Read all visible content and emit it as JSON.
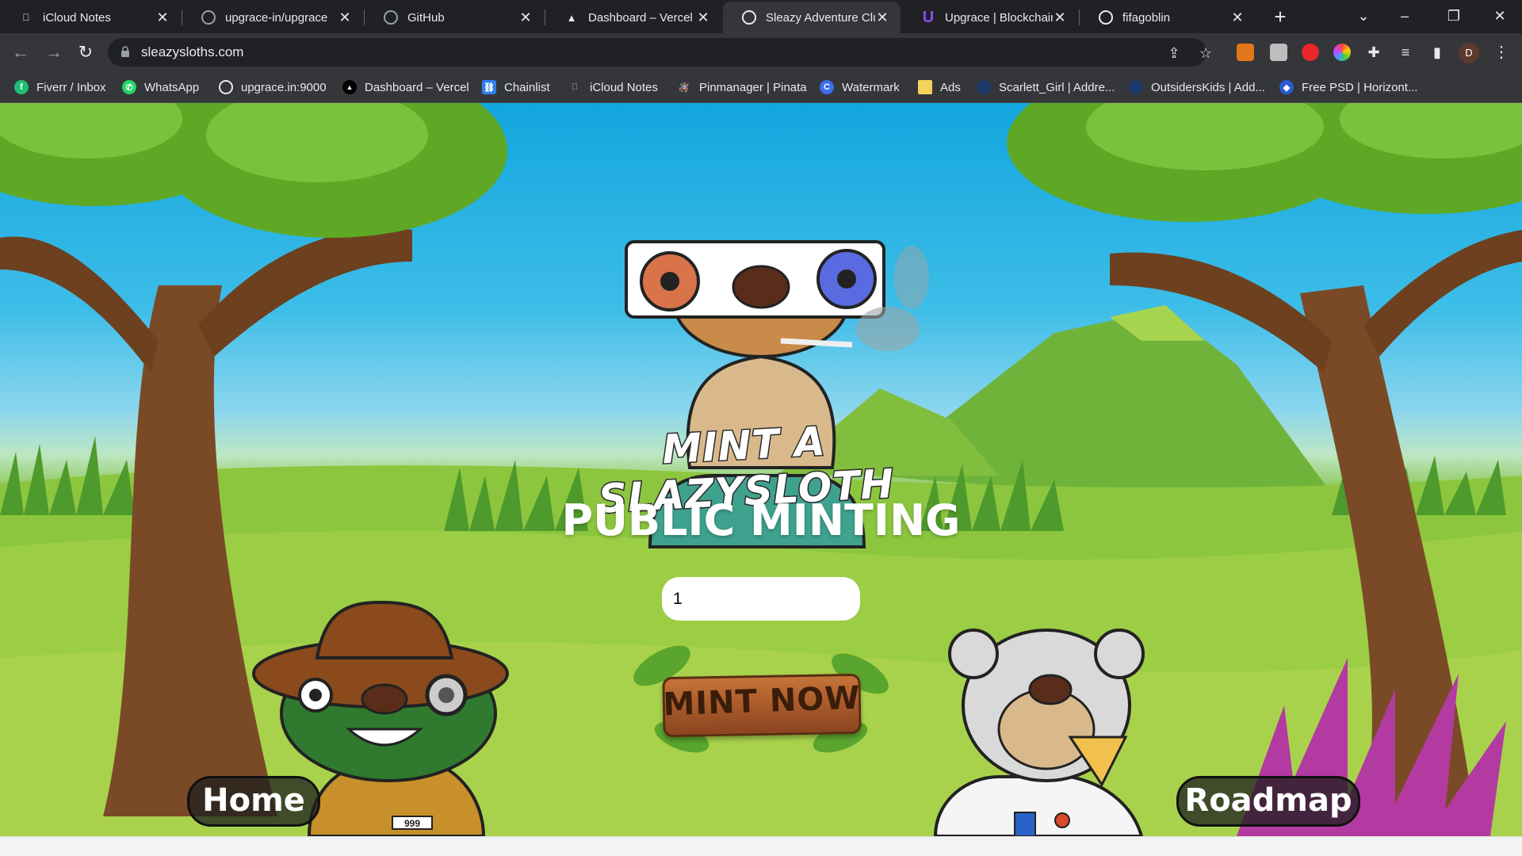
{
  "browser": {
    "tabs": [
      {
        "title": "iCloud Notes",
        "active": false
      },
      {
        "title": "upgrace-in/upgrace",
        "active": false
      },
      {
        "title": "GitHub",
        "active": false
      },
      {
        "title": "Dashboard – Vercel",
        "active": false
      },
      {
        "title": "Sleazy Adventure Club",
        "active": true
      },
      {
        "title": "Upgrace | Blockchain",
        "active": false
      },
      {
        "title": "fifagoblin",
        "active": false
      }
    ],
    "url": "sleazysloths.com",
    "profile_initial": "D",
    "bookmarks": [
      "Fiverr / Inbox",
      "WhatsApp",
      "upgrace.in:9000",
      "Dashboard – Vercel",
      "Chainlist",
      "iCloud Notes",
      "Pinmanager | Pinata",
      "Watermark",
      "Ads",
      "Scarlett_Girl | Addre...",
      "OutsidersKids | Add...",
      "Free PSD | Horizont..."
    ]
  },
  "page": {
    "mint_banner": "MINT A SLAZYSLOTH",
    "heading": "PUBLIC MINTING",
    "quantity_value": "1",
    "mint_button": "MINT NOW",
    "home_button": "Home",
    "roadmap_button": "Roadmap",
    "badge_number": "999"
  }
}
